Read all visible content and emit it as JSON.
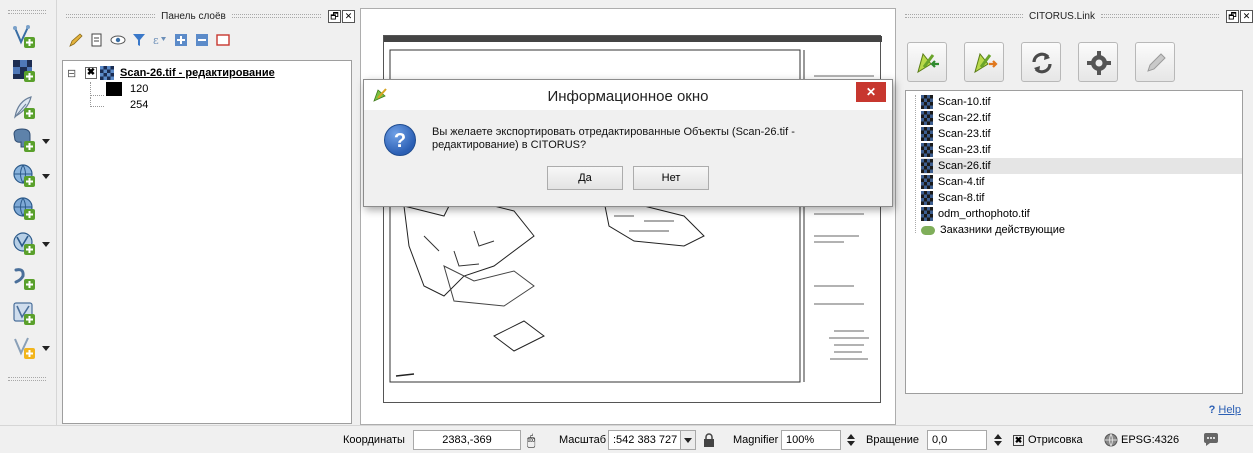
{
  "layers_panel": {
    "title": "Панель слоёв",
    "float_glyph": "🗗",
    "close_glyph": "✕",
    "layer": {
      "name": "Scan-26.tif - редактирование",
      "collapse_glyph": "⊟",
      "values": [
        "120",
        "254"
      ]
    }
  },
  "dialog": {
    "title": "Информационное окно",
    "message": "Вы желаете экспортировать отредактированные Объекты (Scan-26.tif - редактирование) в CITORUS?",
    "yes_label": "Да",
    "no_label": "Нет",
    "close_glyph": "✕",
    "question_glyph": "?"
  },
  "citorus_panel": {
    "title": "CITORUS.Link",
    "float_glyph": "🗗",
    "close_glyph": "✕",
    "items": [
      {
        "label": "Scan-10.tif",
        "kind": "raster"
      },
      {
        "label": "Scan-22.tif",
        "kind": "raster"
      },
      {
        "label": "Scan-23.tif",
        "kind": "raster"
      },
      {
        "label": "Scan-23.tif",
        "kind": "raster"
      },
      {
        "label": "Scan-26.tif",
        "kind": "raster",
        "selected": true
      },
      {
        "label": "Scan-4.tif",
        "kind": "raster"
      },
      {
        "label": "Scan-8.tif",
        "kind": "raster"
      },
      {
        "label": "odm_orthophoto.tif",
        "kind": "raster"
      },
      {
        "label": "Заказники действующие",
        "kind": "polygon"
      }
    ],
    "help_prefix": "?",
    "help_label": "Help"
  },
  "statusbar": {
    "coords_label": "Координаты",
    "coords_value": "2383,-369",
    "scale_label": "Масштаб",
    "scale_value": ":542 383 727",
    "magnifier_label": "Magnifier",
    "magnifier_value": "100%",
    "rotation_label": "Вращение",
    "rotation_value": "0,0",
    "render_label": "Отрисовка",
    "crs_label": "EPSG:4326"
  },
  "colors": {
    "accent_green": "#7cc142",
    "close_red": "#c7372f",
    "question_blue": "#2b5fb4",
    "selection": "#e5e5e5"
  }
}
